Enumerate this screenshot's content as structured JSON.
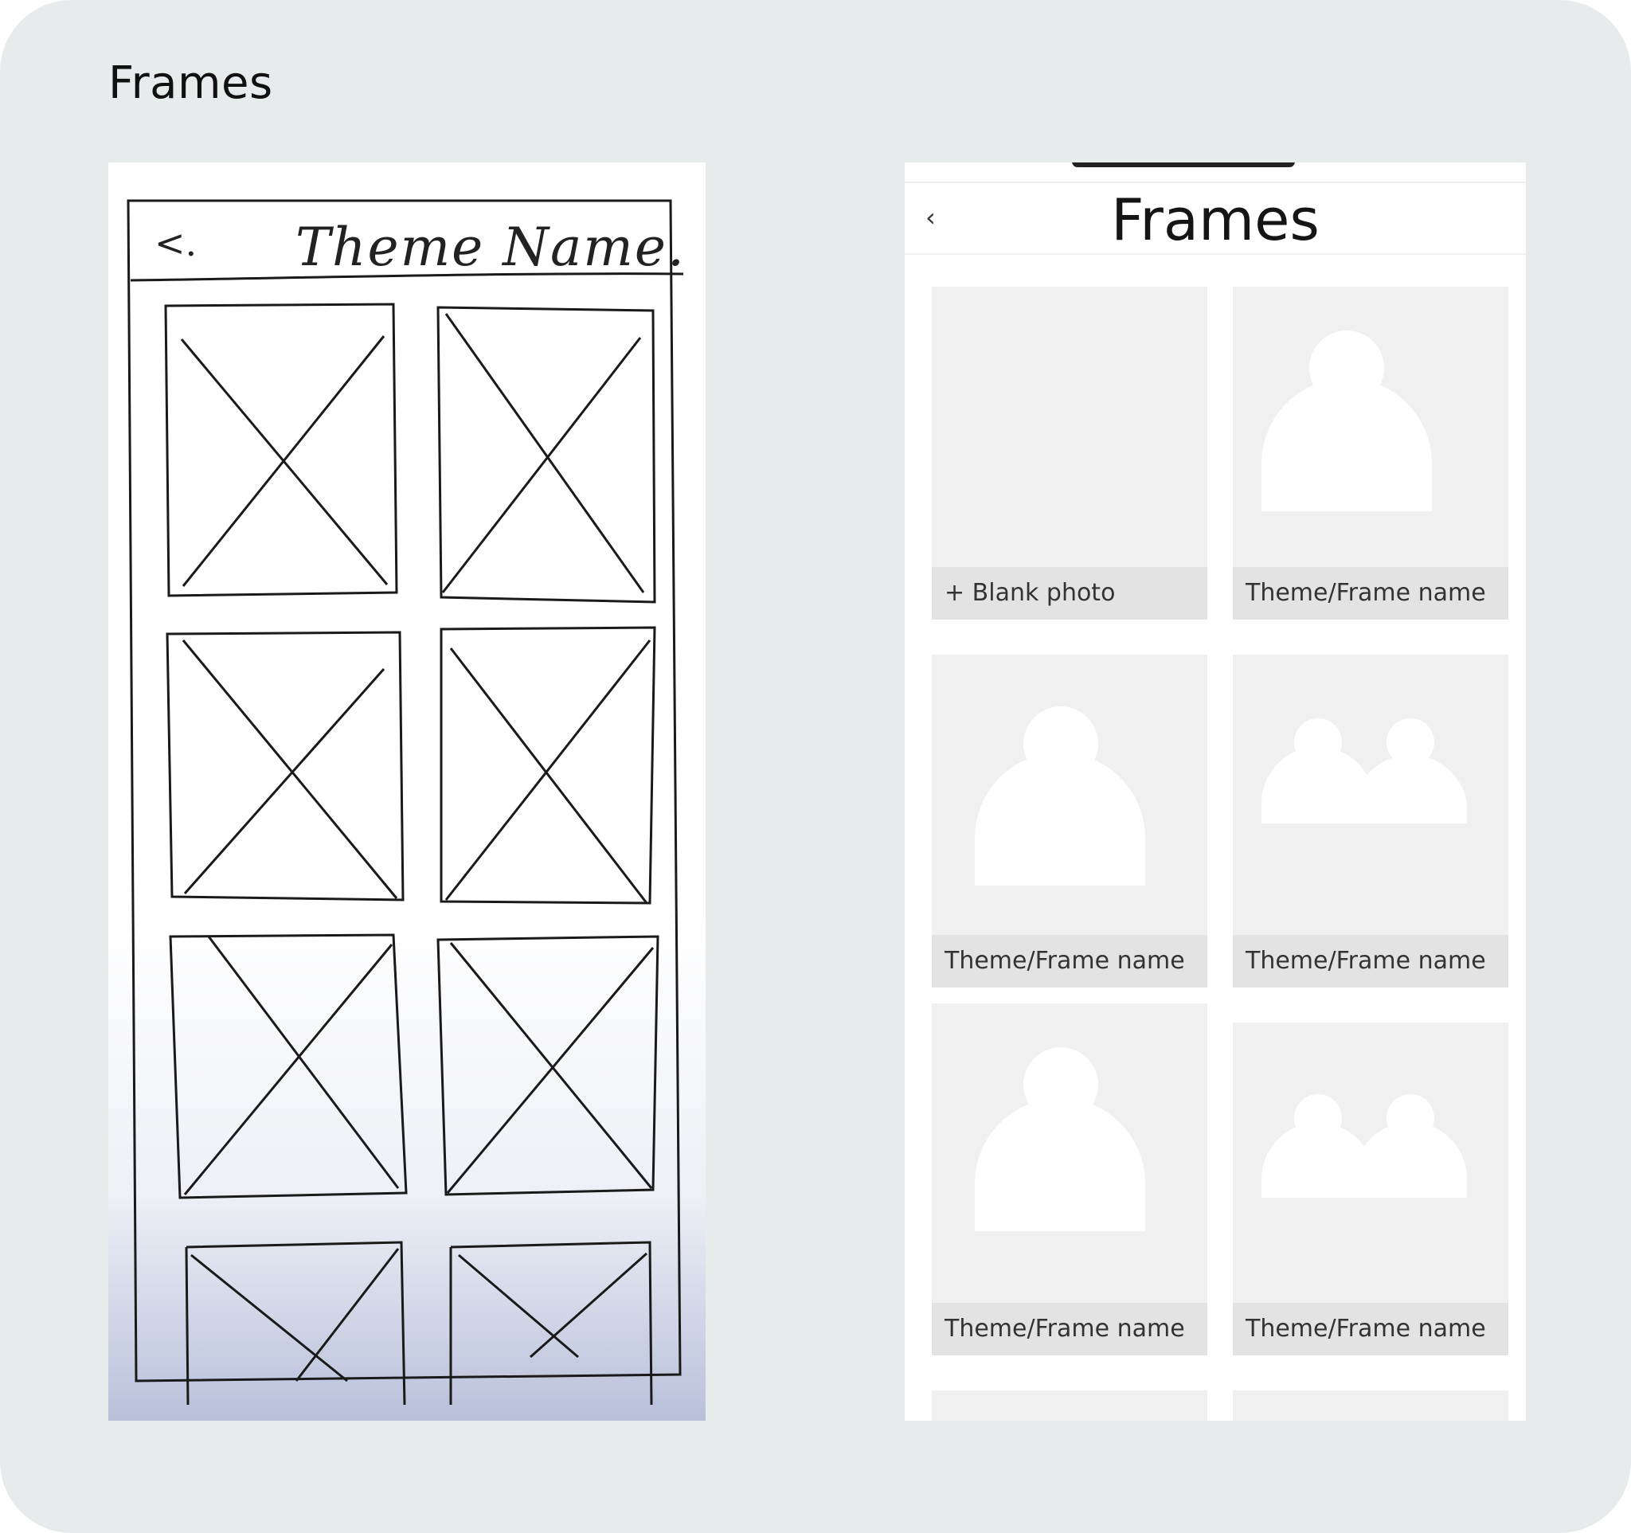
{
  "page": {
    "title": "Frames"
  },
  "sketch": {
    "back_glyph": "<.",
    "title": "Theme Name."
  },
  "wireframe": {
    "header": {
      "back_glyph": "‹",
      "title": "Frames"
    },
    "tiles": [
      {
        "label": "+ Blank photo",
        "icon": "none"
      },
      {
        "label": "Theme/Frame name",
        "icon": "person-icon"
      },
      {
        "label": "Theme/Frame name",
        "icon": "person-icon"
      },
      {
        "label": "Theme/Frame name",
        "icon": "two-persons-icon"
      },
      {
        "label": "Theme/Frame name",
        "icon": "person-icon"
      },
      {
        "label": "Theme/Frame name",
        "icon": "two-persons-icon"
      }
    ]
  }
}
